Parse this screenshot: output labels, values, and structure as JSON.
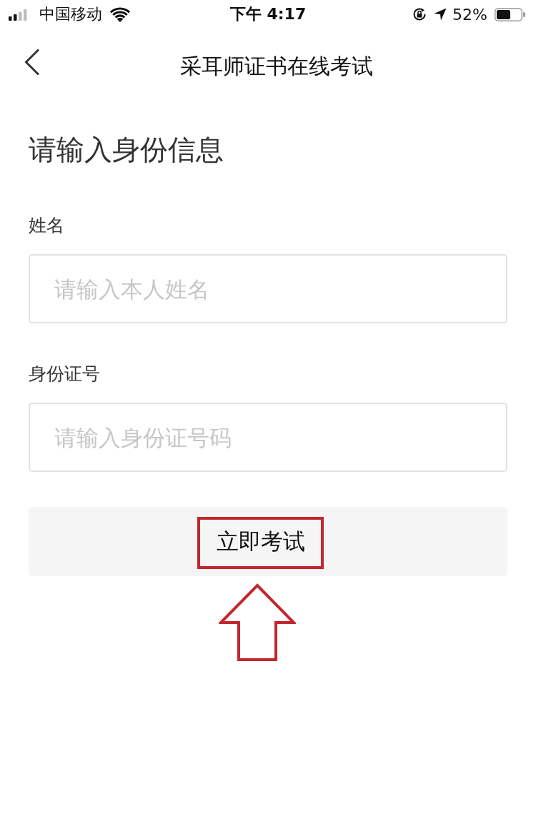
{
  "status_bar": {
    "carrier": "中国移动",
    "time": "下午 4:17",
    "battery": "52%"
  },
  "nav_bar": {
    "title": "采耳师证书在线考试"
  },
  "form": {
    "heading": "请输入身份信息",
    "fields": [
      {
        "label": "姓名",
        "placeholder": "请输入本人姓名"
      },
      {
        "label": "身份证号",
        "placeholder": "请输入身份证号码"
      }
    ],
    "submit_button": "立即考试"
  }
}
